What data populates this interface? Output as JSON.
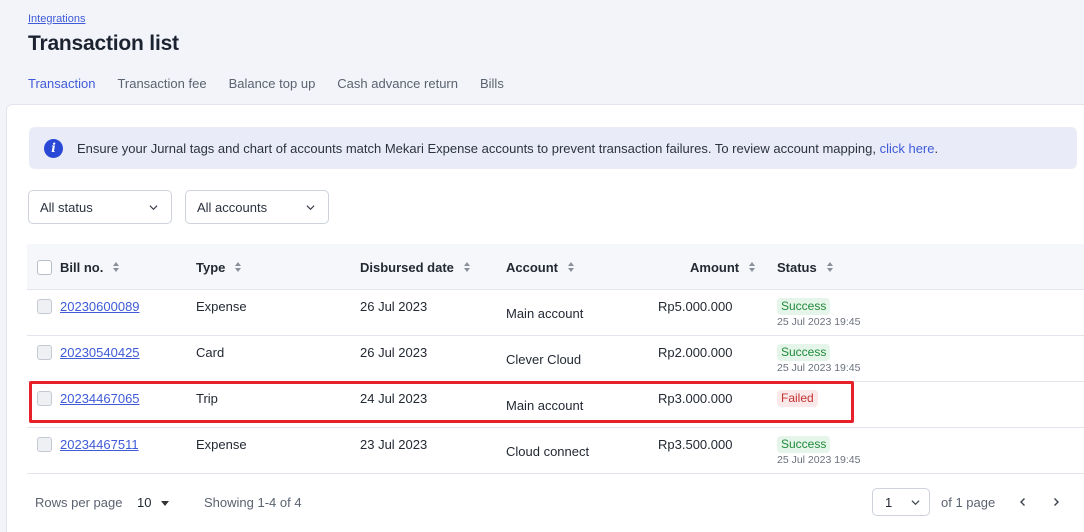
{
  "header": {
    "breadcrumb": "Integrations",
    "title": "Transaction list"
  },
  "tabs": [
    {
      "label": "Transaction",
      "active": true
    },
    {
      "label": "Transaction fee",
      "active": false
    },
    {
      "label": "Balance top up",
      "active": false
    },
    {
      "label": "Cash advance return",
      "active": false
    },
    {
      "label": "Bills",
      "active": false
    }
  ],
  "banner": {
    "icon": "info-icon",
    "icon_glyph": "i",
    "text": "Ensure your Jurnal tags and chart of accounts match Mekari Expense accounts to prevent transaction failures. To review account mapping, ",
    "link": "click here",
    "suffix": "."
  },
  "filters": {
    "status": "All status",
    "accounts": "All accounts"
  },
  "table": {
    "columns": {
      "bill_no": "Bill no.",
      "type": "Type",
      "disbursed_date": "Disbursed date",
      "account": "Account",
      "amount": "Amount",
      "status": "Status"
    },
    "rows": [
      {
        "bill_no": "20230600089",
        "type": "Expense",
        "date": "26 Jul 2023",
        "account": "Main account",
        "amount": "Rp5.000.000",
        "status": "Success",
        "status_time": "25 Jul 2023 19:45"
      },
      {
        "bill_no": "20230540425",
        "type": "Card",
        "date": "26 Jul 2023",
        "account": "Clever Cloud",
        "amount": "Rp2.000.000",
        "status": "Success",
        "status_time": "25 Jul 2023 19:45"
      },
      {
        "bill_no": "20234467065",
        "type": "Trip",
        "date": "24 Jul 2023",
        "account": "Main account",
        "amount": "Rp3.000.000",
        "status": "Failed",
        "status_time": ""
      },
      {
        "bill_no": "20234467511",
        "type": "Expense",
        "date": "23 Jul 2023",
        "account": "Cloud connect",
        "amount": "Rp3.500.000",
        "status": "Success",
        "status_time": "25 Jul 2023 19:45"
      }
    ]
  },
  "footer": {
    "rows_per_page_label": "Rows per page",
    "rows_per_page_value": "10",
    "showing": "Showing 1-4 of 4",
    "page_value": "1",
    "of_pages": "of 1 page"
  },
  "colors": {
    "accent": "#3f5bd8",
    "success": "#1f8a3a",
    "failed": "#c43232",
    "highlight": "#e8202a"
  }
}
